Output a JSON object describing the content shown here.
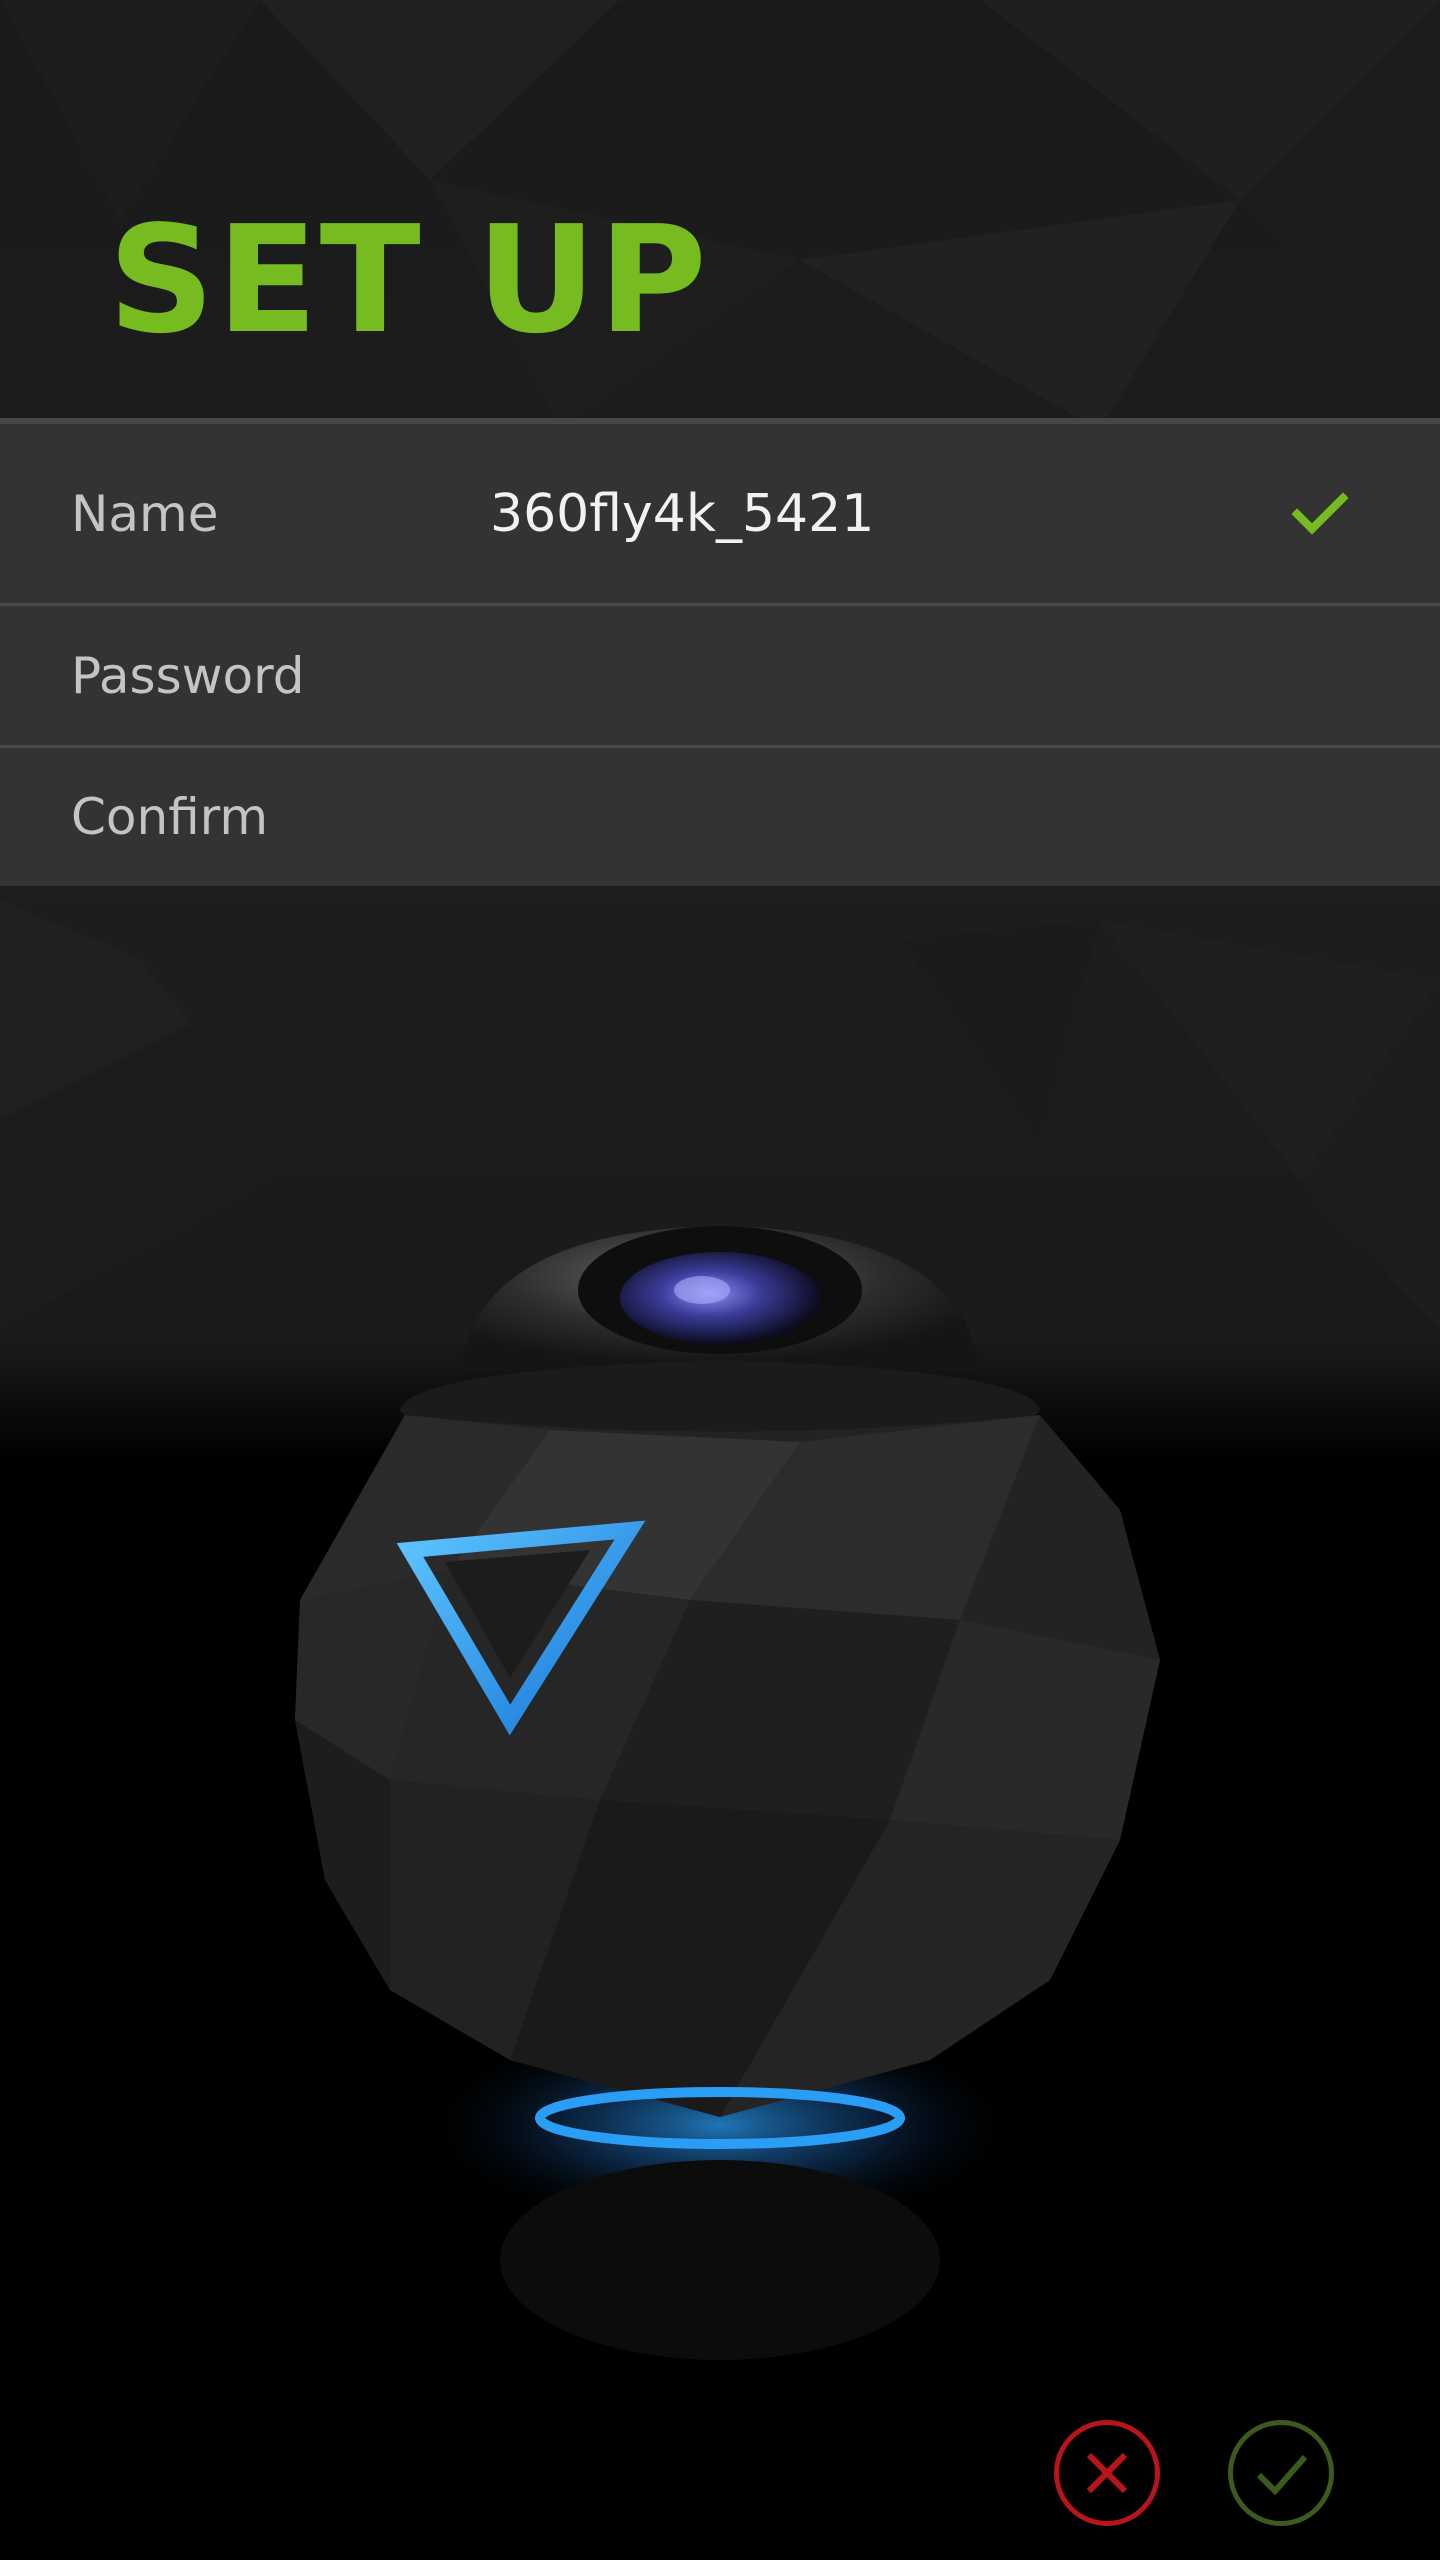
{
  "header": {
    "title": "SET UP"
  },
  "form": {
    "name": {
      "label": "Name",
      "value": "360fly4k_5421",
      "valid": true
    },
    "password": {
      "label": "Password",
      "value": ""
    },
    "confirm": {
      "label": "Confirm",
      "value": ""
    }
  },
  "actions": {
    "cancel_icon": "close-circle-icon",
    "confirm_icon": "check-circle-icon"
  },
  "colors": {
    "accent_green": "#76bc21",
    "cancel_red": "#b8141a",
    "confirm_green": "#3d5a1e",
    "camera_blue": "#2a9df4"
  }
}
